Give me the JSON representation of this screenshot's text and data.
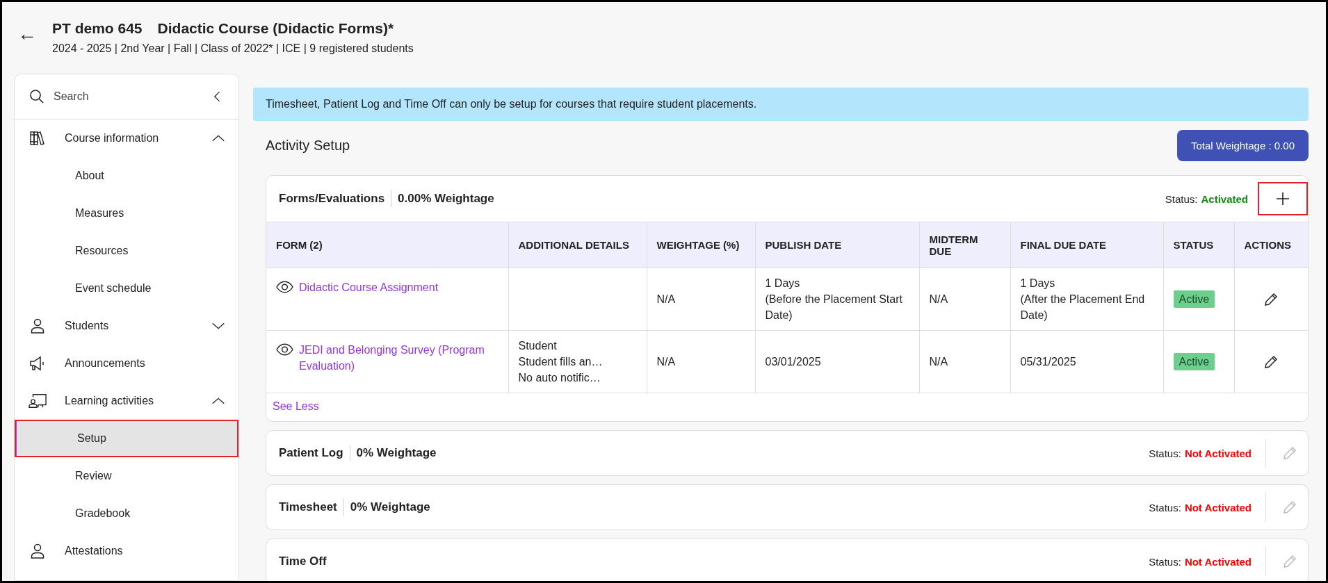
{
  "header": {
    "back": "←",
    "code": "PT demo 645",
    "title": "Didactic Course (Didactic Forms)*",
    "subtitle": "2024 - 2025 | 2nd Year | Fall | Class of 2022* | ICE | 9 registered students"
  },
  "sidebar": {
    "search": {
      "placeholder": "Search"
    },
    "items": [
      {
        "label": "Course information",
        "kind": "books",
        "expanded": true,
        "selected": false,
        "children": [
          {
            "label": "About",
            "selected": false
          },
          {
            "label": "Measures",
            "selected": false
          },
          {
            "label": "Resources",
            "selected": false
          },
          {
            "label": "Event schedule",
            "selected": false
          }
        ]
      },
      {
        "label": "Students",
        "kind": "person",
        "expanded": false,
        "selected": false
      },
      {
        "label": "Announcements",
        "kind": "megaphone",
        "selected": false
      },
      {
        "label": "Learning activities",
        "kind": "classroom",
        "expanded": true,
        "selected": false,
        "children": [
          {
            "label": "Setup",
            "selected": true
          },
          {
            "label": "Review",
            "selected": false
          },
          {
            "label": "Gradebook",
            "selected": false
          }
        ]
      },
      {
        "label": "Attestations",
        "kind": "person",
        "selected": false
      }
    ]
  },
  "banner": "Timesheet, Patient Log and Time Off can only be setup for courses that require student placements.",
  "section_title": "Activity Setup",
  "total_button": "Total Weightage : 0.00",
  "activities": [
    {
      "title": "Forms/Evaluations",
      "weightage": "0.00% Weightage",
      "status_label": "Status:",
      "status": "Activated",
      "activated": true,
      "action": {
        "kind": "add"
      },
      "table": {
        "columns": [
          "FORM (2)",
          "ADDITIONAL DETAILS",
          "WEIGHTAGE (%)",
          "PUBLISH DATE",
          "MIDTERM DUE",
          "FINAL DUE DATE",
          "STATUS",
          "ACTIONS"
        ],
        "rows": [
          {
            "form": "Didactic Course Assignment",
            "details": [],
            "weightage": "N/A",
            "publish": [
              "1 Days",
              "(Before the Placement Start Date)"
            ],
            "midterm": "N/A",
            "final": [
              "1 Days",
              "(After the Placement End Date)"
            ],
            "status": "Active"
          },
          {
            "form": "JEDI and Belonging Survey (Program Evaluation)",
            "details": [
              "Student",
              "Student fills an…",
              "No auto notific…"
            ],
            "weightage": "N/A",
            "publish": [
              "03/01/2025"
            ],
            "midterm": "N/A",
            "final": [
              "05/31/2025"
            ],
            "status": "Active"
          }
        ]
      },
      "see_less": "See Less"
    },
    {
      "title": "Patient Log",
      "weightage": "0% Weightage",
      "status_label": "Status:",
      "status": "Not Activated",
      "activated": false,
      "action": {
        "kind": "edit",
        "disabled": true
      }
    },
    {
      "title": "Timesheet",
      "weightage": "0% Weightage",
      "status_label": "Status:",
      "status": "Not Activated",
      "activated": false,
      "action": {
        "kind": "edit",
        "disabled": true
      }
    },
    {
      "title": "Time Off",
      "status_label": "Status:",
      "status": "Not Activated",
      "activated": false,
      "action": {
        "kind": "edit",
        "disabled": true
      }
    }
  ]
}
